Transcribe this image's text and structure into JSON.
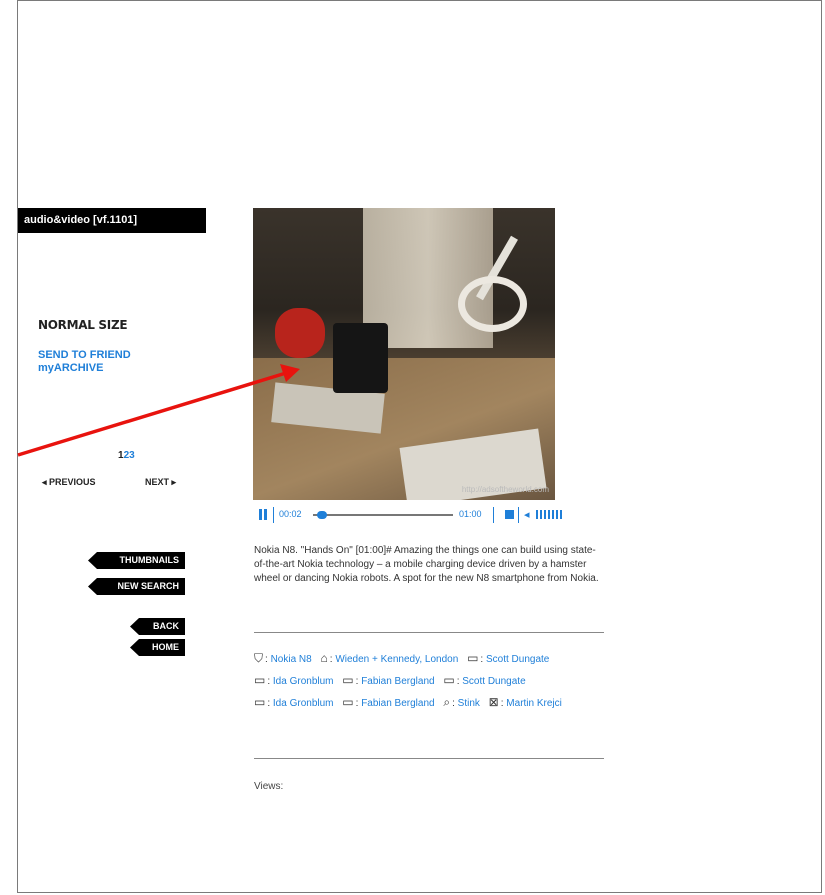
{
  "section_label": "audio&video [vf.1101]",
  "sidebar": {
    "size_label": "NORMAL SIZE",
    "send_to_friend": "SEND TO FRIEND",
    "my_archive": "myARCHIVE",
    "pages": [
      "1",
      "2",
      "3"
    ],
    "current_page": "1",
    "previous": "◂ PREVIOUS",
    "next": "NEXT ▸"
  },
  "buttons": {
    "thumbnails": "THUMBNAILS",
    "new_search": "NEW SEARCH",
    "back": "BACK",
    "home": "HOME"
  },
  "video": {
    "watermark": "http://adsoftheworld.com",
    "current_time": "00:02",
    "duration": "01:00",
    "progress": 0.03
  },
  "description": "Nokia N8. \"Hands On\" [01:00]# Amazing the things one can build using state-of-the-art Nokia technology – a mobile charging device driven by a hamster wheel or dancing Nokia robots. A spot for the new N8 smartphone from Nokia.",
  "credits": [
    {
      "icon": "product-icon",
      "glyph": "⛉",
      "name": "Nokia N8"
    },
    {
      "icon": "agency-icon",
      "glyph": "⌂",
      "name": "Wieden + Kennedy, London"
    },
    {
      "icon": "camera-icon",
      "glyph": "▭",
      "name": "Scott Dungate"
    },
    {
      "icon": "camera-icon",
      "glyph": "▭",
      "name": "Ida Gronblum"
    },
    {
      "icon": "camera-icon",
      "glyph": "▭",
      "name": "Fabian Bergland"
    },
    {
      "icon": "camera-icon",
      "glyph": "▭",
      "name": "Scott Dungate"
    },
    {
      "icon": "camera-icon",
      "glyph": "▭",
      "name": "Ida Gronblum"
    },
    {
      "icon": "camera-icon",
      "glyph": "▭",
      "name": "Fabian Bergland"
    },
    {
      "icon": "production-icon",
      "glyph": "⌕",
      "name": "Stink"
    },
    {
      "icon": "director-icon",
      "glyph": "⊠",
      "name": "Martin Krejci"
    }
  ],
  "views_label": "Views:",
  "colors": {
    "link": "#1f7fd8",
    "arrow": "#e8130e",
    "button_bg": "#000000"
  }
}
